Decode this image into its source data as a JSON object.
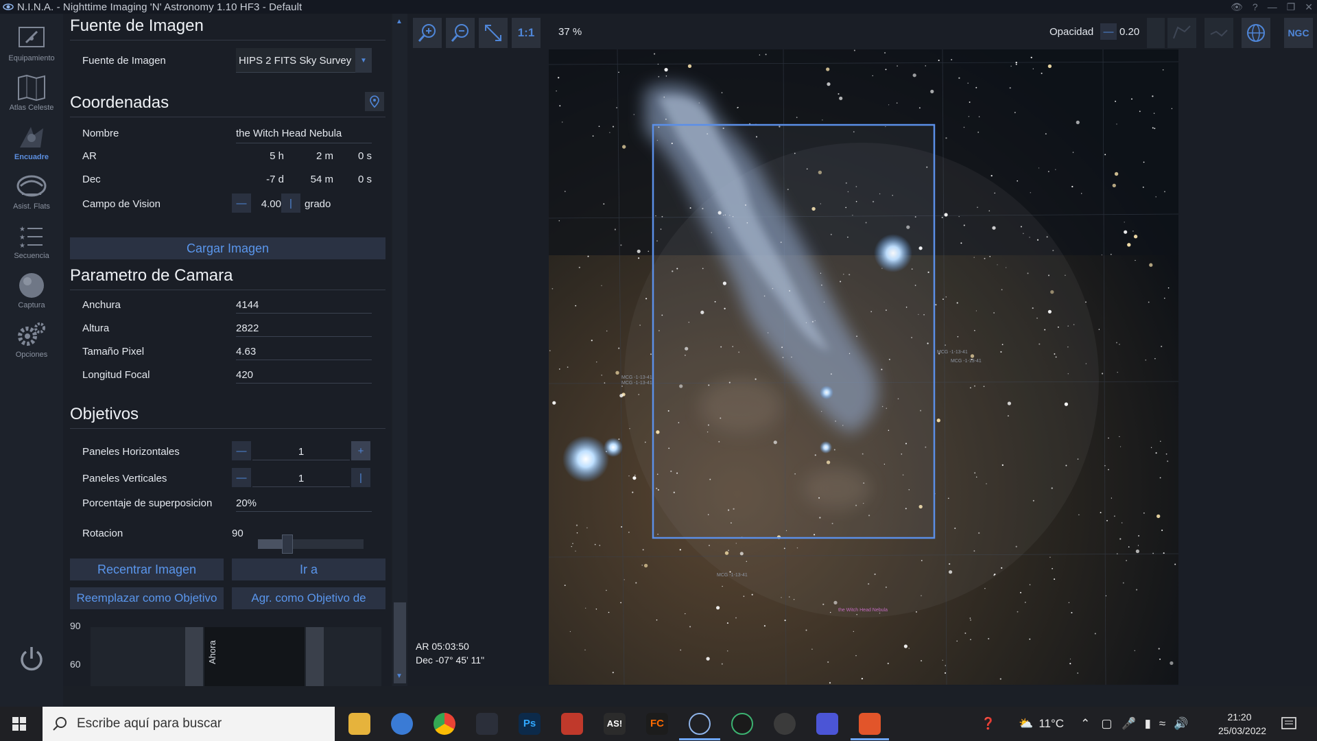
{
  "window": {
    "title": "N.I.N.A. - Nighttime Imaging 'N' Astronomy 1.10 HF3   -  Default"
  },
  "nav": {
    "items": [
      {
        "label": "Equipamiento",
        "icon": "telescope-icon"
      },
      {
        "label": "Atlas Celeste",
        "icon": "sky-atlas-icon"
      },
      {
        "label": "Encuadre",
        "icon": "framing-icon"
      },
      {
        "label": "Asist. Flats",
        "icon": "flats-wizard-icon"
      },
      {
        "label": "Secuencia",
        "icon": "sequence-icon"
      },
      {
        "label": "Captura",
        "icon": "capture-icon"
      },
      {
        "label": "Opciones",
        "icon": "gear-icon"
      }
    ],
    "active": "Encuadre"
  },
  "image_source": {
    "title": "Fuente de Imagen",
    "label": "Fuente de Imagen",
    "value": "HIPS 2 FITS Sky Survey"
  },
  "coordinates": {
    "title": "Coordenadas",
    "name_label": "Nombre",
    "name_value": "the Witch Head Nebula",
    "ra_label": "AR",
    "ra_h": "5 h",
    "ra_m": "2 m",
    "ra_s": "0 s",
    "dec_label": "Dec",
    "dec_d": "-7 d",
    "dec_m": "54 m",
    "dec_s": "0 s",
    "fov_label": "Campo de Vision",
    "fov_value": "4.00",
    "fov_unit": "grado",
    "load_button": "Cargar Imagen"
  },
  "camera": {
    "title": "Parametro de Camara",
    "width_label": "Anchura",
    "width_value": "4144",
    "height_label": "Altura",
    "height_value": "2822",
    "pixel_label": "Tamaño Pixel",
    "pixel_value": "4.63",
    "focal_label": "Longitud Focal",
    "focal_value": "420"
  },
  "targets": {
    "title": "Objetivos",
    "hpanels_label": "Paneles Horizontales",
    "hpanels_value": "1",
    "vpanels_label": "Paneles Verticales",
    "vpanels_value": "1",
    "overlap_label": "Porcentaje de superposicion",
    "overlap_value": "20%",
    "rotation_label": "Rotacion",
    "rotation_value": "90",
    "rotation_slider_fraction": 0.25,
    "recenter_button": "Recentrar Imagen",
    "goto_button": "Ir a",
    "replace_button": "Reemplazar como Objetivo",
    "add_button": "Agr. como Objetivo de"
  },
  "altitude_chart": {
    "y_ticks": [
      "90",
      "60"
    ],
    "now_label": "Ahora"
  },
  "toolbar": {
    "one_to_one": "1:1",
    "zoom": "37 %",
    "opacity_label": "Opacidad",
    "opacity_value": "0.20",
    "ngc_label": "NGC"
  },
  "sky_view": {
    "ra_readout": "AR 05:03:50",
    "dec_readout": "Dec -07° 45' 11\"",
    "labels": [
      "MCG -1-13-41",
      "MCG -1-13-41",
      "MCG -1-13-41",
      "MCG -1-13-41",
      "MCG -1-13-41",
      "the Witch Head Nebula"
    ]
  },
  "taskbar": {
    "search_placeholder": "Escribe aquí para buscar",
    "temperature": "11°C",
    "time": "21:20",
    "date": "25/03/2022"
  },
  "colors": {
    "accent": "#4f86d8",
    "frame": "#5b8fe8",
    "panel_bg": "#1a1e26"
  }
}
